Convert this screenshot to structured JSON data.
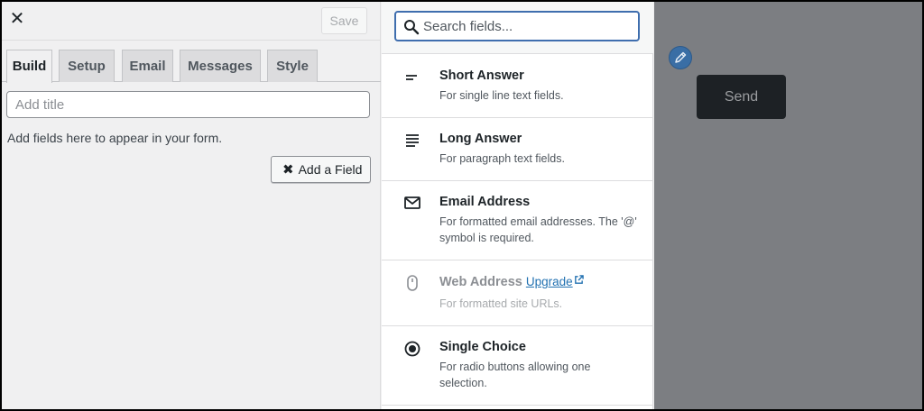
{
  "topbar": {
    "close_glyph": "✕",
    "save_label": "Save"
  },
  "tabs": [
    {
      "label": "Build",
      "active": true
    },
    {
      "label": "Setup",
      "active": false
    },
    {
      "label": "Email",
      "active": false
    },
    {
      "label": "Messages",
      "active": false
    },
    {
      "label": "Style",
      "active": false
    }
  ],
  "form": {
    "title_placeholder": "Add title",
    "hint": "Add fields here to appear in your form.",
    "add_field_icon": "✖",
    "add_field_label": "Add a Field"
  },
  "search": {
    "placeholder": "Search fields...",
    "icon": "search-icon"
  },
  "fields": [
    {
      "title": "Short Answer",
      "desc": "For single line text fields.",
      "icon": "short-text-icon"
    },
    {
      "title": "Long Answer",
      "desc": "For paragraph text fields.",
      "icon": "paragraph-icon"
    },
    {
      "title": "Email Address",
      "desc": "For formatted email addresses. The '@' symbol is required.",
      "icon": "envelope-icon"
    },
    {
      "title": "Web Address",
      "upgrade": "Upgrade",
      "desc": "For formatted site URLs.",
      "icon": "mouse-icon",
      "disabled": true
    },
    {
      "title": "Single Choice",
      "desc": "For radio buttons allowing one selection.",
      "icon": "radio-icon"
    }
  ],
  "preview": {
    "send_label": "Send",
    "edit_icon": "pencil-icon"
  },
  "colors": {
    "accent": "#3f6eae",
    "link": "#2271b1",
    "preview_bg": "#7c7e82",
    "send_bg": "#1d2125"
  }
}
